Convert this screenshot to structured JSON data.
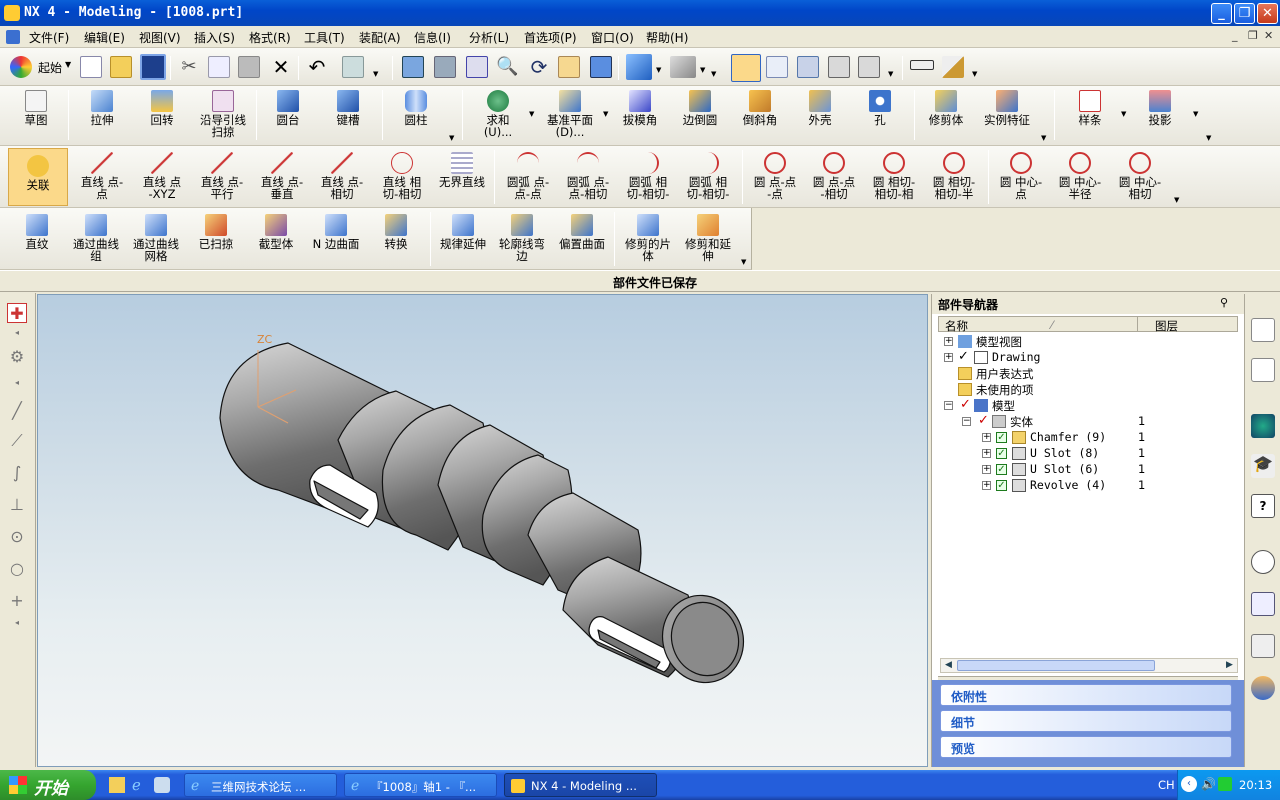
{
  "window": {
    "title": "NX 4 - Modeling - [1008.prt]"
  },
  "menu": [
    "文件(F)",
    "编辑(E)",
    "视图(V)",
    "插入(S)",
    "格式(R)",
    "工具(T)",
    "装配(A)",
    "信息(I)",
    "分析(L)",
    "首选项(P)",
    "窗口(O)",
    "帮助(H)"
  ],
  "standard_toolbar": {
    "start_label": "起始"
  },
  "feature_toolbar": [
    "草图",
    "拉伸",
    "回转",
    "沿导引线\n扫掠",
    "圆台",
    "键槽",
    "圆柱",
    "求和\n(U)...",
    "基准平面\n(D)...",
    "拔模角",
    "边倒圆",
    "倒斜角",
    "外壳",
    "孔",
    "修剪体",
    "实例特征",
    "样条",
    "投影"
  ],
  "curve_toolbar": [
    "关联",
    "直线 点-\n点",
    "直线 点\n-XYZ",
    "直线 点-\n平行",
    "直线 点-\n垂直",
    "直线 点-\n相切",
    "直线 相\n切-相切",
    "无界直线",
    "圆弧 点-\n点-点",
    "圆弧 点-\n点-相切",
    "圆弧 相\n切-相切-",
    "圆弧 相\n切-相切-",
    "圆 点-点\n-点",
    "圆 点-点\n-相切",
    "圆 相切-\n相切-相",
    "圆 相切-\n相切-半",
    "圆 中心-\n点",
    "圆 中心-\n半径",
    "圆 中心-\n相切"
  ],
  "surface_toolbar": [
    "直纹",
    "通过曲线\n组",
    "通过曲线\n网格",
    "已扫掠",
    "截型体",
    "N 边曲面",
    "转换",
    "规律延伸",
    "轮廓线弯\n边",
    "偏置曲面",
    "修剪的片\n体",
    "修剪和延\n伸"
  ],
  "status": {
    "message": "部件文件已保存"
  },
  "viewport": {
    "axis_label": "ZC"
  },
  "navigator": {
    "title": "部件导航器",
    "col_name": "名称",
    "col_layer": "图层",
    "nodes": [
      {
        "label": "模型视图",
        "layer": ""
      },
      {
        "label": "Drawing",
        "layer": ""
      },
      {
        "label": "用户表达式",
        "layer": ""
      },
      {
        "label": "未使用的项",
        "layer": ""
      },
      {
        "label": "模型",
        "layer": ""
      },
      {
        "label": "实体",
        "layer": "1"
      },
      {
        "label": "Chamfer (9)",
        "layer": "1"
      },
      {
        "label": "U Slot (8)",
        "layer": "1"
      },
      {
        "label": "U Slot (6)",
        "layer": "1"
      },
      {
        "label": "Revolve (4)",
        "layer": "1"
      }
    ],
    "panels": [
      "依附性",
      "细节",
      "预览"
    ]
  },
  "taskbar": {
    "start": "开始",
    "tasks": [
      "三维网技术论坛 ...",
      "『1008』轴1 - 『...",
      "NX 4 - Modeling ..."
    ],
    "tray_lang": "CH",
    "clock": "20:13"
  }
}
